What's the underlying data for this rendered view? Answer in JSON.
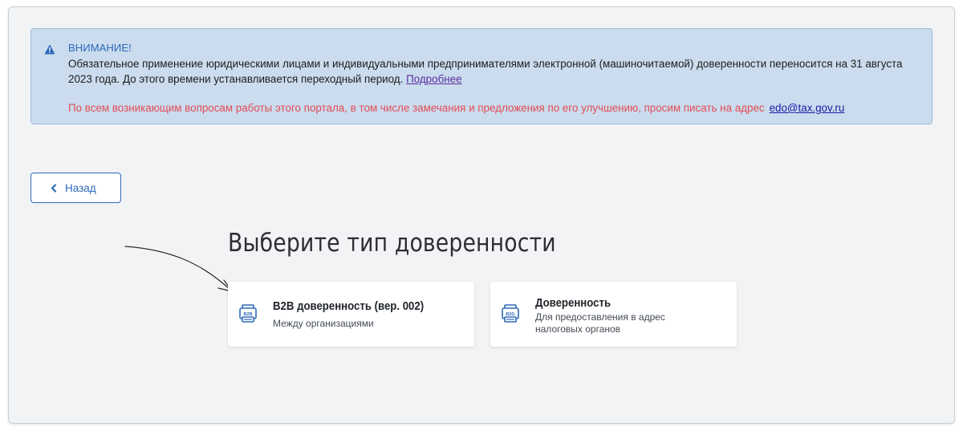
{
  "alert": {
    "title": "ВНИМАНИЕ!",
    "text": "Обязательное применение юридическими лицами и индивидуальными предпринимателями электронной (машиночитаемой) доверенности переносится на 31 августа 2023 года. До этого времени устанавливается переходный период.",
    "more_link": "Подробнее",
    "note": "По всем возникающим вопросам работы этого портала, в том числе замечания и предложения по его улучшению, просим писать на адрес",
    "email": "edo@tax.gov.ru"
  },
  "back_button": {
    "label": "Назад"
  },
  "heading": "Выберите тип доверенности",
  "cards": [
    {
      "title": "B2B доверенность (вер. 002)",
      "subtitle": "Между организациями",
      "icon": "b2b-document-icon",
      "icon_text": "B2B"
    },
    {
      "title": "Доверенность",
      "subtitle": "Для предоставления в адрес налоговых органов",
      "icon": "b2g-document-icon",
      "icon_text": "B2G"
    }
  ],
  "colors": {
    "accent": "#2f6ab8",
    "alert_bg": "#cadcee",
    "alert_note": "#e44c56",
    "page_bg": "#f2f3f5"
  }
}
